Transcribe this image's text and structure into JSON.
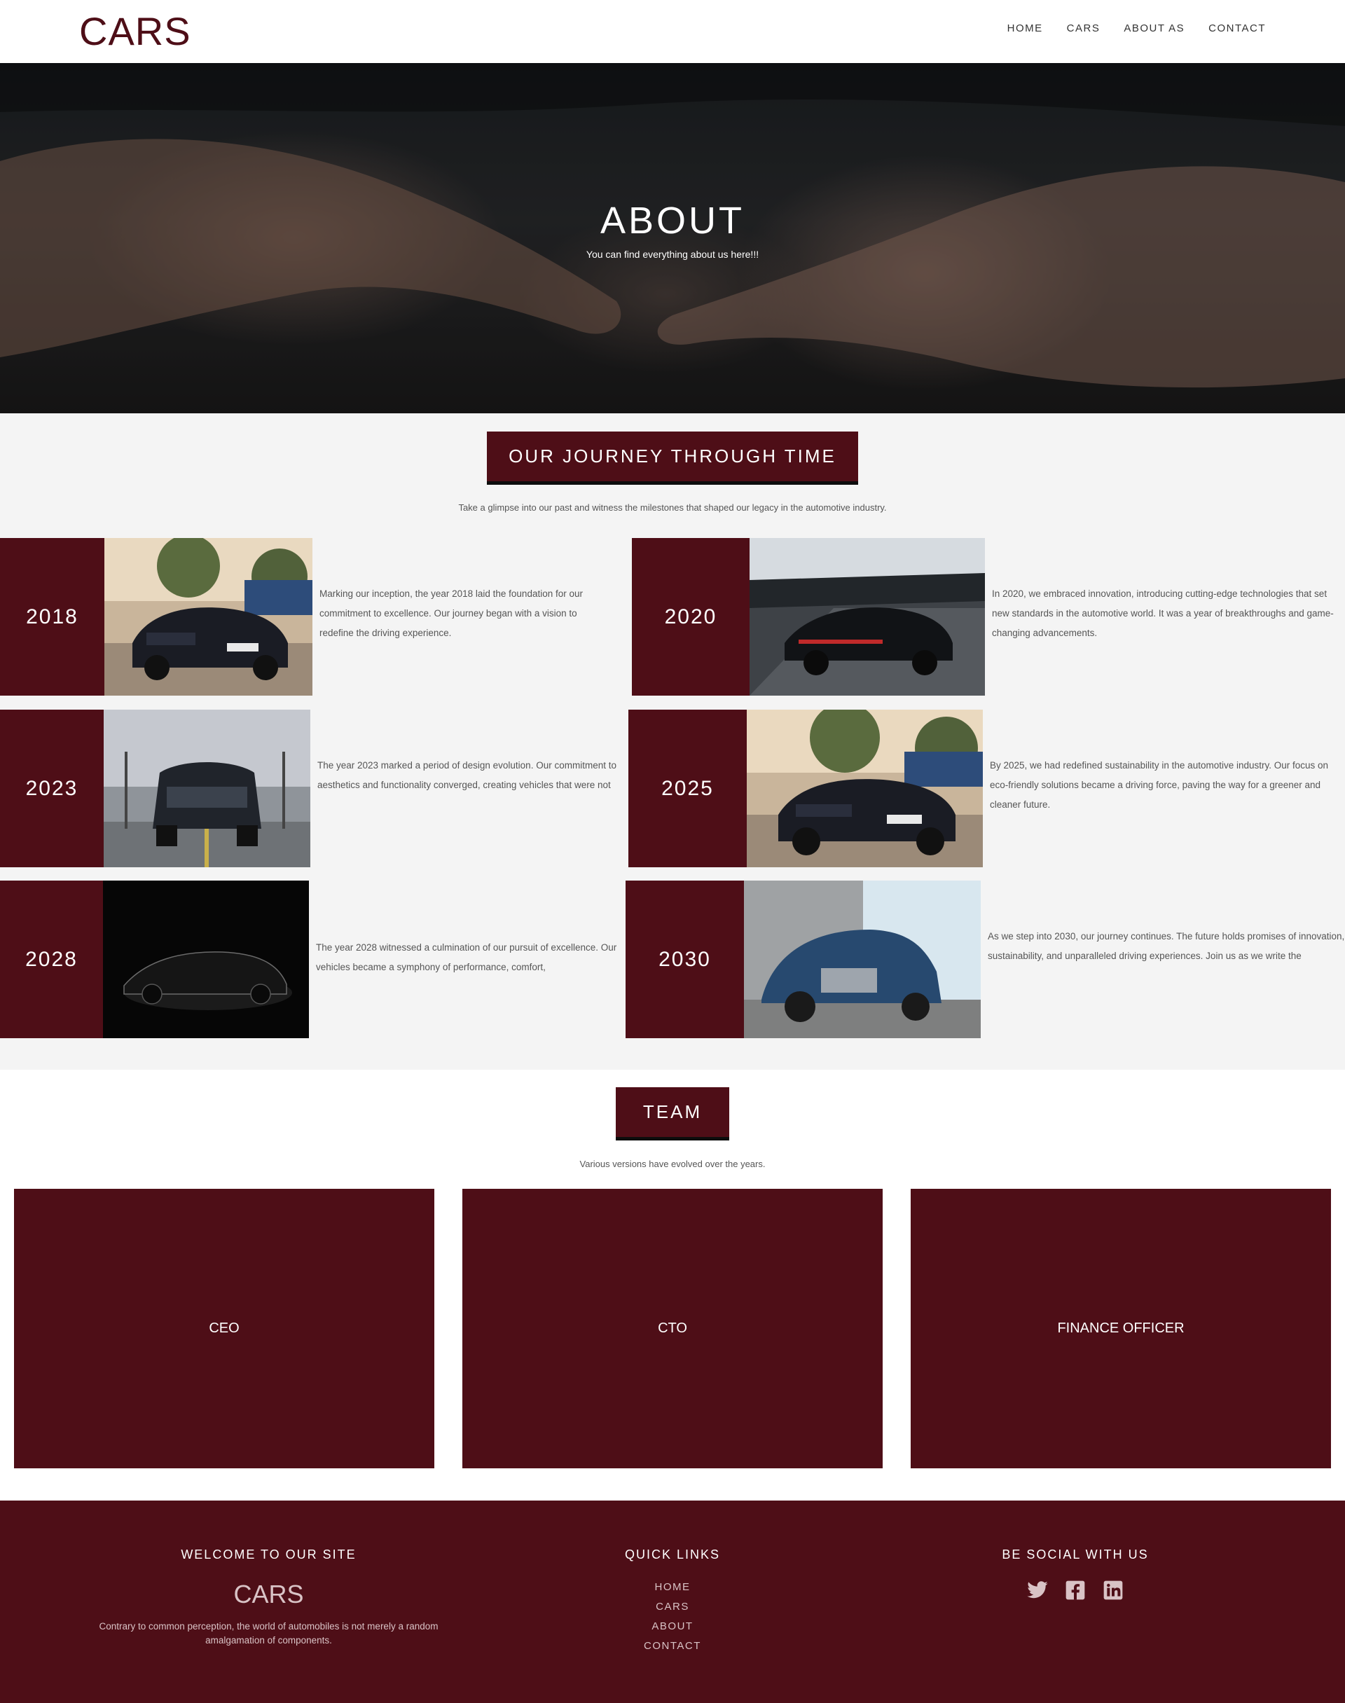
{
  "header": {
    "logo": "CARS",
    "nav": [
      "HOME",
      "CARS",
      "ABOUT AS",
      "CONTACT"
    ]
  },
  "hero": {
    "title": "ABOUT",
    "subtitle": "You can find everything about us here!!!"
  },
  "journey": {
    "title": "OUR JOURNEY THROUGH TIME",
    "subtitle": "Take a glimpse into our past and witness the milestones that shaped our legacy in the automotive industry.",
    "items": [
      {
        "year": "2018",
        "text": "Marking our inception, the year 2018 laid the foundation for our commitment to excellence. Our journey began with a vision to redefine the driving experience."
      },
      {
        "year": "2020",
        "text": "In 2020, we embraced innovation, introducing cutting-edge technologies that set new standards in the automotive world. It was a year of breakthroughs and game-changing advancements."
      },
      {
        "year": "2023",
        "text": "The year 2023 marked a period of design evolution. Our commitment to aesthetics and functionality converged, creating vehicles that were not"
      },
      {
        "year": "2025",
        "text": "By 2025, we had redefined sustainability in the automotive industry. Our focus on eco-friendly solutions became a driving force, paving the way for a greener and cleaner future."
      },
      {
        "year": "2028",
        "text": "The year 2028 witnessed a culmination of our pursuit of excellence. Our vehicles became a symphony of performance, comfort,"
      },
      {
        "year": "2030",
        "text": "As we step into 2030, our journey continues. The future holds promises of innovation, sustainability, and unparalleled driving experiences. Join us as we write the"
      }
    ]
  },
  "team": {
    "title": "TEAM",
    "subtitle": "Various versions have evolved over the years.",
    "members": [
      "CEO",
      "CTO",
      "FINANCE OFFICER"
    ]
  },
  "footer": {
    "welcome_heading": "WELCOME TO OUR SITE",
    "logo": "CARS",
    "welcome_text": "Contrary to common perception, the world of automobiles is not merely a random amalgamation of components.",
    "links_heading": "QUICK LINKS",
    "links": [
      "HOME",
      "CARS",
      "ABOUT",
      "CONTACT"
    ],
    "social_heading": "BE SOCIAL WITH US",
    "social_icons": [
      "twitter-icon",
      "facebook-icon",
      "linkedin-icon"
    ]
  },
  "colors": {
    "brand": "#4e0e17",
    "section_bg": "#f4f4f4"
  }
}
